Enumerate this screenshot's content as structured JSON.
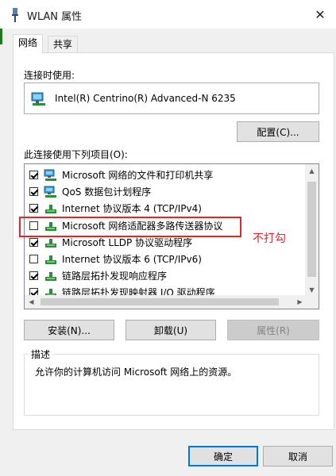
{
  "window": {
    "title": "WLAN 属性"
  },
  "tabs": [
    {
      "label": "网络",
      "active": true
    },
    {
      "label": "共享",
      "active": false
    }
  ],
  "connection": {
    "label": "连接时使用:",
    "adapter_name": "Intel(R) Centrino(R) Advanced-N 6235",
    "configure_button": "配置(C)..."
  },
  "items_label": "此连接使用下列项目(O):",
  "items": [
    {
      "label": "Microsoft 网络的文件和打印机共享",
      "checked": true,
      "icon": "network-client-icon"
    },
    {
      "label": "QoS 数据包计划程序",
      "checked": true,
      "icon": "network-client-icon"
    },
    {
      "label": "Internet 协议版本 4 (TCP/IPv4)",
      "checked": true,
      "icon": "protocol-icon"
    },
    {
      "label": "Microsoft 网络适配器多路传送器协议",
      "checked": false,
      "icon": "protocol-icon"
    },
    {
      "label": "Microsoft LLDP 协议驱动程序",
      "checked": true,
      "icon": "protocol-icon"
    },
    {
      "label": "Internet 协议版本 6 (TCP/IPv6)",
      "checked": false,
      "icon": "protocol-icon"
    },
    {
      "label": "链路层拓扑发现响应程序",
      "checked": true,
      "icon": "protocol-icon"
    },
    {
      "label": "链路层拓扑发现映射器 I/O 驱动程序",
      "checked": true,
      "icon": "protocol-icon"
    }
  ],
  "buttons": {
    "install": "安装(N)...",
    "uninstall": "卸载(U)",
    "properties": "属性(R)",
    "ok": "确定",
    "cancel": "取消"
  },
  "annotation": {
    "text": "不打勾",
    "color": "#e0262c"
  },
  "description": {
    "legend": "描述",
    "text": "允许你的计算机访问 Microsoft 网络上的资源。"
  },
  "colors": {
    "accent": "#0078d7",
    "annotation_red": "#e0262c"
  }
}
